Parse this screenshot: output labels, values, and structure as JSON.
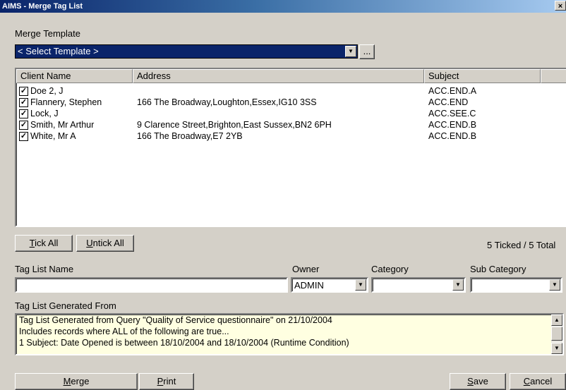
{
  "window": {
    "title": "AIMS - Merge Tag List",
    "close_glyph": "×"
  },
  "template": {
    "label": "Merge Template",
    "value": "< Select Template >",
    "browse_label": "..."
  },
  "grid": {
    "columns": [
      "Client Name",
      "Address",
      "Subject"
    ],
    "rows": [
      {
        "checked": true,
        "name": "Doe 2, J",
        "address": "",
        "subject": "ACC.END.A"
      },
      {
        "checked": true,
        "name": "Flannery, Stephen",
        "address": "166 The Broadway,Loughton,Essex,IG10 3SS",
        "subject": "ACC.END"
      },
      {
        "checked": true,
        "name": "Lock, J",
        "address": "",
        "subject": "ACC.SEE.C"
      },
      {
        "checked": true,
        "name": "Smith, Mr Arthur",
        "address": "9 Clarence Street,Brighton,East Sussex,BN2 6PH",
        "subject": "ACC.END.B"
      },
      {
        "checked": true,
        "name": "White, Mr A",
        "address": "166 The Broadway,E7 2YB",
        "subject": "ACC.END.B"
      }
    ],
    "check_glyph": "✓"
  },
  "buttons": {
    "tick_all": {
      "key": "T",
      "rest": "ick All"
    },
    "untick_all": {
      "key": "U",
      "rest": "ntick All"
    },
    "merge": {
      "key": "M",
      "rest": "erge"
    },
    "print": {
      "key": "P",
      "rest": "rint"
    },
    "save": {
      "key": "S",
      "rest": "ave"
    },
    "cancel": {
      "key": "C",
      "rest": "ancel"
    }
  },
  "tick_status": "5 Ticked / 5 Total",
  "fields": {
    "tag_list_name_label": "Tag List Name",
    "tag_list_name_value": "",
    "owner_label": "Owner",
    "owner_value": "ADMIN",
    "category_label": "Category",
    "category_value": "",
    "sub_category_label": "Sub Category",
    "sub_category_value": ""
  },
  "generated_from": {
    "label": "Tag List Generated From",
    "lines": [
      "Tag List Generated from Query \"Quality of Service questionnaire\" on 21/10/2004",
      "Includes records where ALL of the following are true...",
      "1  Subject: Date Opened is between 18/10/2004 and 18/10/2004 (Runtime Condition)"
    ]
  },
  "icons": {
    "dropdown": "▼",
    "scroll_up": "▲",
    "scroll_down": "▼"
  }
}
